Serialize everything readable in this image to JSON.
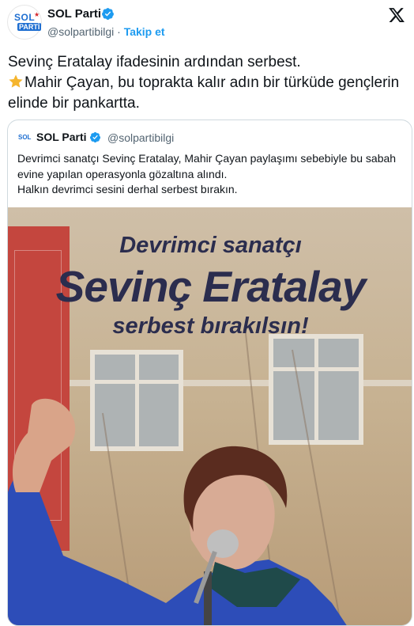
{
  "author": {
    "name": "SOL Parti",
    "handle": "@solpartibilgi",
    "separator": "·",
    "follow_label": "Takip et",
    "avatar_text": "SOL",
    "avatar_subtext": "PARTİ"
  },
  "icons": {
    "verified": "verified-badge-icon",
    "x_logo": "x-logo-icon",
    "star": "star-emoji-icon"
  },
  "colors": {
    "accent": "#1d9bf0",
    "brand_red": "#d4252a",
    "headline": "#2b2d4e"
  },
  "tweet": {
    "line1": "Sevinç Eratalay ifadesinin ardından serbest.",
    "line2": "Mahir Çayan, bu toprakta kalır adın bir türküde gençlerin elinde bir pankartta."
  },
  "quote": {
    "name": "SOL Parti",
    "handle": "@solpartibilgi",
    "text_line1": "Devrimci sanatçı Sevinç Eratalay, Mahir Çayan paylaşımı sebebiyle bu sabah evine yapılan operasyonla gözaltına alındı.",
    "text_line2": "Halkın devrimci sesini derhal serbest bırakın.",
    "image": {
      "headline_top": "Devrimci sanatçı",
      "headline_main": "Sevinç Eratalay",
      "headline_bottom": "serbest bırakılsın!"
    }
  }
}
